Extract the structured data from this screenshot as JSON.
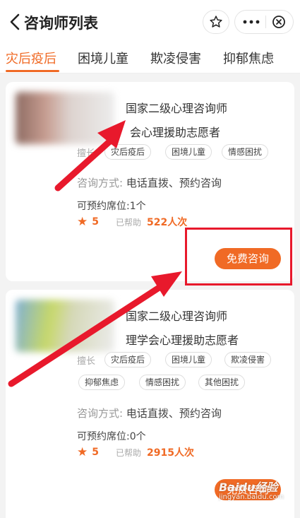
{
  "header": {
    "title": "咨询师列表",
    "back_icon": "chevron-left-icon",
    "favorite_icon": "star-outline-icon",
    "more_icon": "more-dots-icon",
    "close_icon": "close-circle-icon"
  },
  "tabs": [
    {
      "label": "灾后疫后",
      "active": true
    },
    {
      "label": "困境儿童",
      "active": false
    },
    {
      "label": "欺凌侵害",
      "active": false
    },
    {
      "label": "抑郁焦虑",
      "active": false
    }
  ],
  "colors": {
    "accent": "#f06a25",
    "annotation_red": "#e8192c"
  },
  "cards": [
    {
      "cert1": "国家二级心理咨询师",
      "cert2": "会心理援助志愿者",
      "tags_label": "擅长",
      "tags": [
        "灾后疫后",
        "困境儿童",
        "情感困扰"
      ],
      "method_label": "咨询方式:",
      "method": "电话直拨、预约咨询",
      "seats": "可预约席位:1个",
      "rating": "5",
      "helped_label": "已帮助",
      "helped": "522人次",
      "button": "免费咨询"
    },
    {
      "cert1": "国家二级心理咨询师",
      "cert2": "理学会心理援助志愿者",
      "tags_label": "擅长",
      "tags": [
        "灾后疫后",
        "困境儿童",
        "欺凌侵害",
        "抑郁焦虑",
        "情感困扰",
        "其他困扰"
      ],
      "method_label": "咨询方式:",
      "method": "电话直拨、预约咨询",
      "seats": "可预约席位:0个",
      "rating": "5",
      "helped_label": "已帮助",
      "helped": "2915人次",
      "button": "免费咨询"
    }
  ],
  "watermark": {
    "brand": "Baidu经验",
    "url": "jingyan.baidu.com"
  }
}
